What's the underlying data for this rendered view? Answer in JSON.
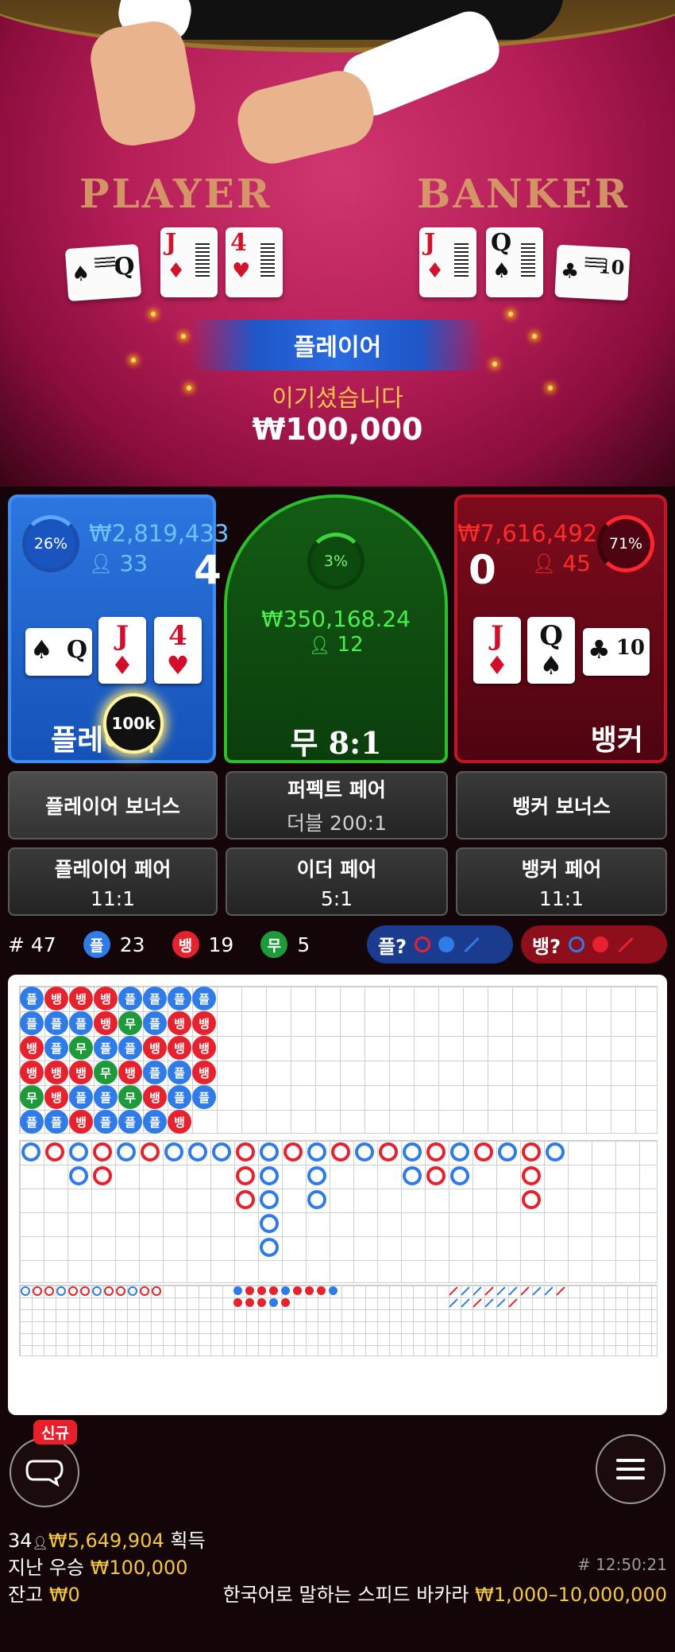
{
  "video": {
    "felt_left": "PLAYER",
    "felt_right": "BANKER",
    "result_label": "플레이어",
    "win_text": "이기셨습니다",
    "win_amount": "₩100,000",
    "player_cards": [
      {
        "rank": "Q",
        "suit": "♠",
        "color": "black"
      },
      {
        "rank": "J",
        "suit": "♦",
        "color": "red"
      },
      {
        "rank": "4",
        "suit": "♥",
        "color": "red"
      }
    ],
    "banker_cards": [
      {
        "rank": "J",
        "suit": "♦",
        "color": "red"
      },
      {
        "rank": "Q",
        "suit": "♠",
        "color": "black"
      },
      {
        "rank": "10",
        "suit": "♣",
        "color": "black"
      }
    ]
  },
  "board": {
    "player": {
      "percent": "26%",
      "total": "₩2,819,433",
      "players": "33",
      "score": "4",
      "label": "플레이어",
      "chip": "100k",
      "cards": [
        {
          "rank": "Q",
          "suit": "♠",
          "color": "black"
        },
        {
          "rank": "J",
          "suit": "♦",
          "color": "red"
        },
        {
          "rank": "4",
          "suit": "♥",
          "color": "red"
        }
      ]
    },
    "tie": {
      "percent": "3%",
      "total": "₩350,168.24",
      "players": "12",
      "label": "무",
      "odds": "8:1"
    },
    "banker": {
      "percent": "71%",
      "total": "₩7,616,492",
      "players": "45",
      "score": "0",
      "label": "뱅커",
      "cards": [
        {
          "rank": "J",
          "suit": "♦",
          "color": "red"
        },
        {
          "rank": "Q",
          "suit": "♠",
          "color": "black"
        },
        {
          "rank": "10",
          "suit": "♣",
          "color": "black"
        }
      ]
    },
    "side_bets": {
      "player_bonus": "플레이어 보너스",
      "perfect_pair": "퍼펙트 페어",
      "perfect_pair_odds": "더블 200:1",
      "banker_bonus": "뱅커 보너스",
      "player_pair": "플레이어 페어",
      "player_pair_odds": "11:1",
      "either_pair": "이더 페어",
      "either_pair_odds": "5:1",
      "banker_pair": "뱅커 페어",
      "banker_pair_odds": "11:1"
    }
  },
  "stats": {
    "rounds_label": "# 47",
    "player_glyph": "플",
    "player_count": "23",
    "banker_glyph": "뱅",
    "banker_count": "19",
    "tie_glyph": "무",
    "tie_count": "5",
    "player_ask": "플?",
    "banker_ask": "뱅?"
  },
  "roadmap": {
    "bead_columns": [
      [
        "플",
        "플",
        "뱅",
        "뱅",
        "무",
        "플"
      ],
      [
        "뱅",
        "플",
        "플",
        "뱅",
        "뱅",
        "플"
      ],
      [
        "뱅",
        "플",
        "무",
        "뱅",
        "플",
        "뱅"
      ],
      [
        "뱅",
        "뱅",
        "플",
        "무",
        "플",
        "플"
      ],
      [
        "플",
        "무",
        "플",
        "뱅",
        "무",
        "플"
      ],
      [
        "플",
        "플",
        "뱅",
        "플",
        "뱅",
        "플"
      ],
      [
        "플",
        "뱅",
        "뱅",
        "플",
        "플",
        "뱅"
      ],
      [
        "플",
        "뱅",
        "뱅",
        "뱅",
        "플",
        ""
      ]
    ],
    "colors": {
      "player": "#2f7be8",
      "banker": "#e5222e",
      "tie": "#1f9a3a"
    }
  },
  "footer": {
    "new_badge": "신규",
    "online_count": "34",
    "winners_amount": "₩5,649,904",
    "winners_label": "획득",
    "last_win_label": "지난 우승",
    "last_win_amount": "₩100,000",
    "round_id": "# 12:50:21",
    "balance_label": "잔고",
    "balance_amount": "₩0",
    "table_name": "한국어로 말하는 스피드 바카라",
    "limits": "₩1,000–10,000,000"
  }
}
